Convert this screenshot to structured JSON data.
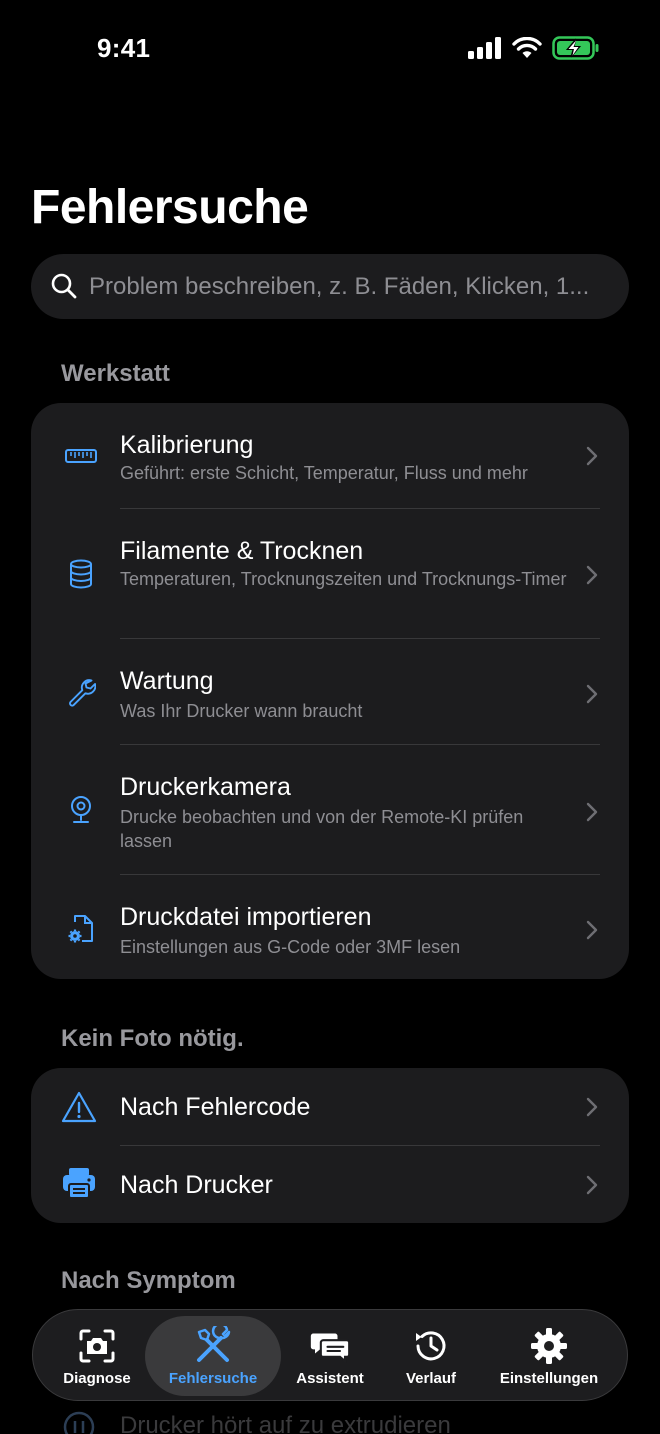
{
  "status": {
    "time": "9:41"
  },
  "page": {
    "title": "Fehlersuche"
  },
  "search": {
    "placeholder": "Problem beschreiben, z. B. Fäden, Klicken, 1..."
  },
  "sections": {
    "workshop": {
      "header": "Werkstatt",
      "items": [
        {
          "title": "Kalibrierung",
          "subtitle": "Geführt: erste Schicht, Temperatur, Fluss und mehr",
          "icon": "ruler-icon"
        },
        {
          "title": "Filamente & Trocknen",
          "subtitle": "Temperaturen, Trocknungszeiten und Trocknungs-Timer",
          "icon": "database-icon"
        },
        {
          "title": "Wartung",
          "subtitle": "Was Ihr Drucker wann braucht",
          "icon": "wrench-icon"
        },
        {
          "title": "Druckerkamera",
          "subtitle": "Drucke beobachten und von der Remote-KI prüfen lassen",
          "icon": "webcam-icon"
        },
        {
          "title": "Druckdatei importieren",
          "subtitle": "Einstellungen aus G-Code oder 3MF lesen",
          "icon": "file-gear-icon"
        }
      ]
    },
    "no_photo": {
      "header": "Kein Foto nötig.",
      "items": [
        {
          "title": "Nach Fehlercode",
          "icon": "warning-icon"
        },
        {
          "title": "Nach Drucker",
          "icon": "printer-icon"
        }
      ]
    },
    "symptom": {
      "header": "Nach Symptom",
      "peek_item": "Drucker hört auf zu extrudieren"
    }
  },
  "tabs": [
    {
      "label": "Diagnose",
      "icon": "camera-icon"
    },
    {
      "label": "Fehlersuche",
      "icon": "tools-icon",
      "active": true
    },
    {
      "label": "Assistent",
      "icon": "chat-icon"
    },
    {
      "label": "Verlauf",
      "icon": "history-icon"
    },
    {
      "label": "Einstellungen",
      "icon": "gear-icon"
    }
  ],
  "colors": {
    "accent": "#4aa3ff",
    "card": "#1c1c1e",
    "secondary_text": "#8e8e93",
    "battery": "#34c759"
  }
}
